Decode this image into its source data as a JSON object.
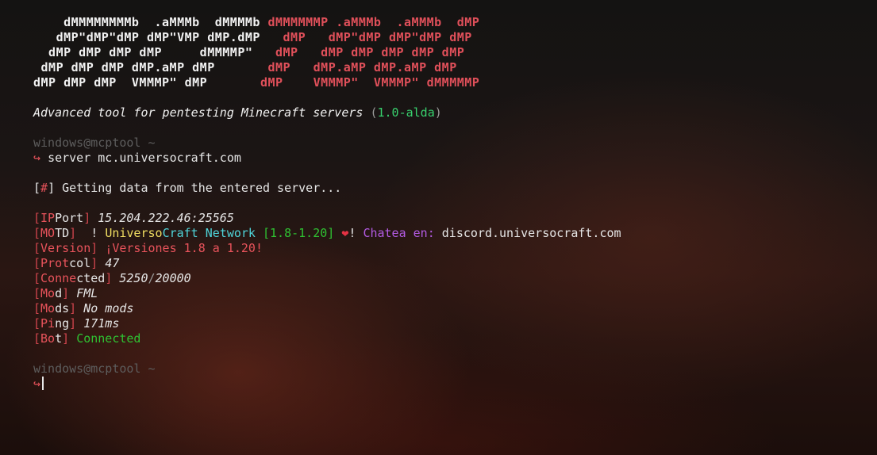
{
  "banner": {
    "rows": [
      {
        "white": "    dMMMMMMMMb  .aMMMb  dMMMMb ",
        "red": "dMMMMMMP .aMMMb  .aMMMb  dMP"
      },
      {
        "white": "   dMP\"dMP\"dMP dMP\"VMP dMP.dMP   ",
        "red": "dMP   dMP\"dMP dMP\"dMP dMP"
      },
      {
        "white": "  dMP dMP dMP dMP     dMMMMP\"   ",
        "red": "dMP   dMP dMP dMP dMP dMP"
      },
      {
        "white": " dMP dMP dMP dMP.aMP dMP       ",
        "red": "dMP   dMP.aMP dMP.aMP dMP"
      },
      {
        "white": "dMP dMP dMP  VMMMP\" dMP       ",
        "red": "dMP    VMMMP\"  VMMMP\" dMMMMMP"
      }
    ]
  },
  "tagline": {
    "text": "Advanced tool for pentesting Minecraft servers",
    "open": "(",
    "version": "1.0-alda",
    "close": ")"
  },
  "prompt1": {
    "user_host": "windows@mcptool ~",
    "arrow": "↪",
    "command": "server mc.universocraft.com"
  },
  "status": {
    "bracket_open": "[",
    "symbol": "#",
    "bracket_close": "]",
    "text": "Getting data from the entered server..."
  },
  "results": {
    "ipport": {
      "l1": "IP",
      "l2": "Port",
      "value": "15.204.222.46:25565"
    },
    "motd": {
      "l1": "MO",
      "l2": "TD",
      "p1": "  ! ",
      "p2": "Universo",
      "p3": "Craft",
      "p4": " Network ",
      "p5": "[1.8-1.20]",
      "p6": " ❤",
      "p7": "! ",
      "p8": "Chatea en: ",
      "p9": "discord.universocraft.com"
    },
    "version": {
      "l1": "Version",
      "value": "¡Versiones 1.8 a 1.20!"
    },
    "protocol": {
      "l1": "Prot",
      "l2": "col",
      "value": "47"
    },
    "connected": {
      "l1": "Conne",
      "l2": "cted",
      "online": "5250",
      "sep": "/",
      "max": "20000"
    },
    "mod": {
      "l1": "Mo",
      "l2": "d",
      "value": "FML"
    },
    "mods": {
      "l1": "Mo",
      "l2": "ds",
      "value": "No mods"
    },
    "ping": {
      "l1": "Pi",
      "l2": "ng",
      "value": "171ms"
    },
    "bot": {
      "l1": "Bo",
      "l2": "t",
      "value": "Connected"
    }
  },
  "prompt2": {
    "user_host": "windows@mcptool ~",
    "arrow": "↪"
  }
}
